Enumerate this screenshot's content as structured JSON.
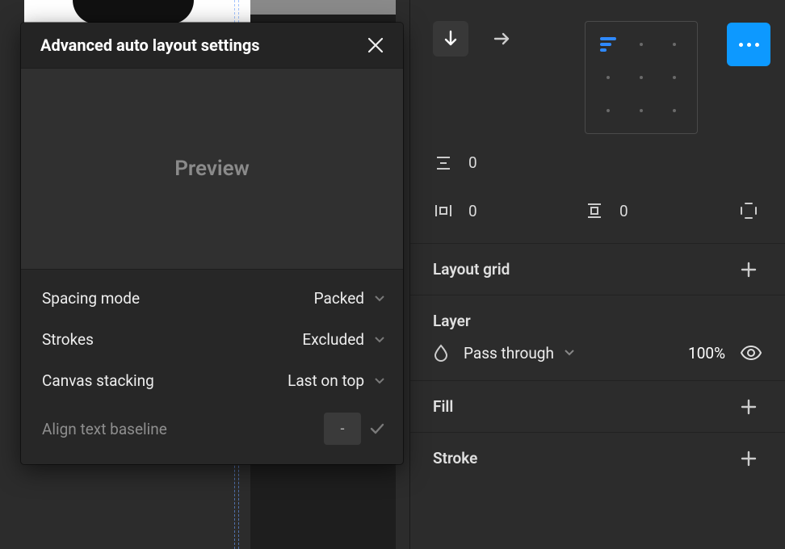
{
  "dialog": {
    "title": "Advanced auto layout settings",
    "preview_label": "Preview",
    "rows": {
      "spacing_mode": {
        "label": "Spacing mode",
        "value": "Packed"
      },
      "strokes": {
        "label": "Strokes",
        "value": "Excluded"
      },
      "canvas_stacking": {
        "label": "Canvas stacking",
        "value": "Last on top"
      },
      "align_text_baseline": {
        "label": "Align text baseline",
        "value": "-"
      }
    }
  },
  "inspector": {
    "autolayout": {
      "vertical_gap": "0",
      "horizontal_padding": "0",
      "vertical_padding": "0"
    },
    "sections": {
      "layout_grid": "Layout grid",
      "layer": "Layer",
      "fill": "Fill",
      "stroke": "Stroke"
    },
    "layer": {
      "blend_mode": "Pass through",
      "opacity": "100%"
    }
  }
}
